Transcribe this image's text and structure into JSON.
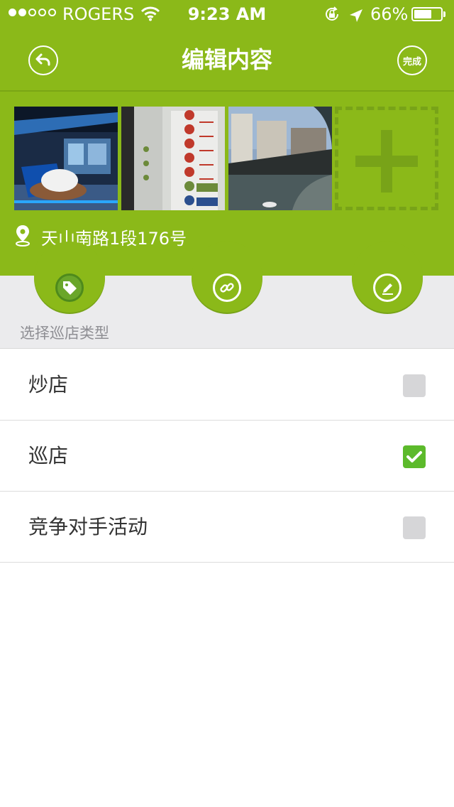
{
  "status_bar": {
    "carrier": "ROGERS",
    "time": "9:23 AM",
    "battery_text": "66%",
    "battery_level": 0.66,
    "signal_bars_filled": 2,
    "signal_bars_total": 5
  },
  "nav": {
    "title": "编辑内容",
    "back_icon": "back-arrow-icon",
    "done_label": "完成"
  },
  "photos": [
    {
      "name": "exhibition-hall-photo",
      "icon": "photo"
    },
    {
      "name": "wayfinding-sign-photo",
      "icon": "photo"
    },
    {
      "name": "modern-building-photo",
      "icon": "photo"
    }
  ],
  "add_photo_icon": "plus-icon",
  "location": {
    "icon": "location-pin-icon",
    "text": "天山南路1段176号"
  },
  "tabs": [
    {
      "icon": "tag-icon",
      "active": true
    },
    {
      "icon": "link-icon",
      "active": false
    },
    {
      "icon": "edit-icon",
      "active": false
    }
  ],
  "section": {
    "label": "选择巡店类型"
  },
  "options": [
    {
      "label": "炒店",
      "checked": false
    },
    {
      "label": "巡店",
      "checked": true
    },
    {
      "label": "竞争对手活动",
      "checked": false
    }
  ],
  "colors": {
    "brand_green": "#8bb919",
    "check_green": "#5cba2b",
    "background_gray": "#ebebed"
  }
}
